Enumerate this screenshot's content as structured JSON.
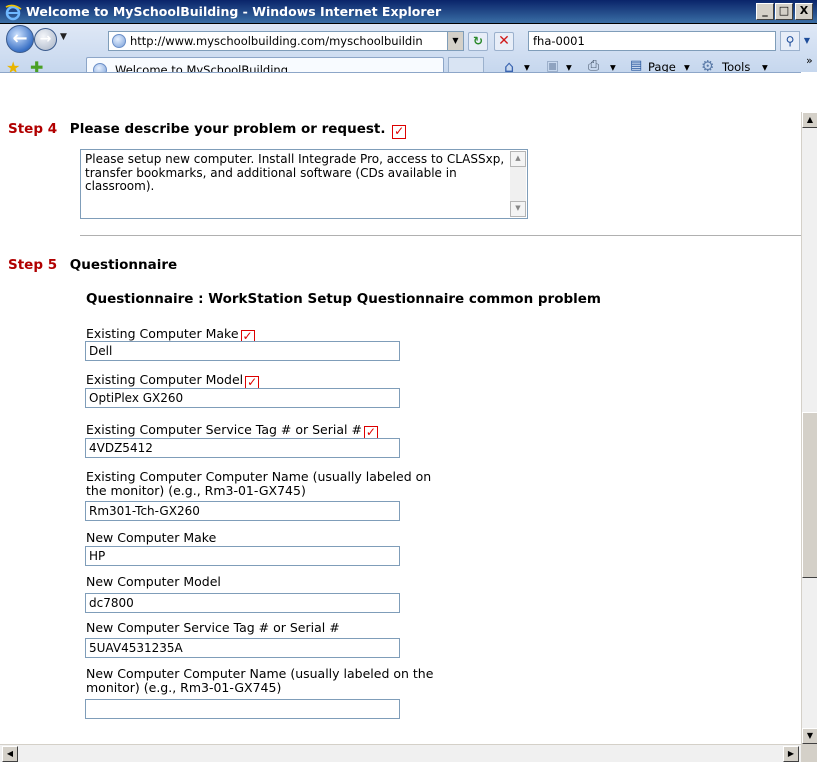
{
  "window": {
    "title": "Welcome to MySchoolBuilding - Windows Internet Explorer",
    "min": "_",
    "max": "□",
    "close": "X"
  },
  "nav": {
    "address": "http://www.myschoolbuilding.com/myschoolbuildin",
    "search": "fha-0001"
  },
  "tab": {
    "label": "Welcome to MySchoolBuilding"
  },
  "commands": {
    "page": "Page",
    "tools": "Tools"
  },
  "form": {
    "step4": {
      "number": "Step 4",
      "label": "Please describe your problem or request.",
      "text": "Please setup new computer.  Install Integrade Pro, access to CLASSxp, transfer bookmarks, and additional software (CDs available in  classroom)."
    },
    "step5": {
      "number": "Step 5",
      "label": "Questionnaire"
    },
    "questionnaire_title": "Questionnaire : WorkStation Setup Questionnaire common problem",
    "fields": [
      {
        "label": "Existing Computer Make",
        "value": "Dell",
        "required": true
      },
      {
        "label": "Existing Computer Model",
        "value": "OptiPlex GX260",
        "required": true
      },
      {
        "label": "Existing Computer Service Tag # or Serial #",
        "value": "4VDZ5412",
        "required": true
      },
      {
        "label": "Existing Computer Computer Name (usually labeled on",
        "label2": "the monitor) (e.g., Rm3-01-GX745)",
        "value": "Rm301-Tch-GX260",
        "required": false
      },
      {
        "label": "New Computer Make",
        "value": "HP",
        "required": false
      },
      {
        "label": "New Computer Model",
        "value": "dc7800",
        "required": false
      },
      {
        "label": "New Computer Service Tag # or Serial #",
        "value": "5UAV4531235A",
        "required": false
      },
      {
        "label": "New Computer Computer Name (usually labeled on the",
        "label2": "monitor) (e.g., Rm3-01-GX745)",
        "value": "",
        "required": false
      }
    ]
  }
}
